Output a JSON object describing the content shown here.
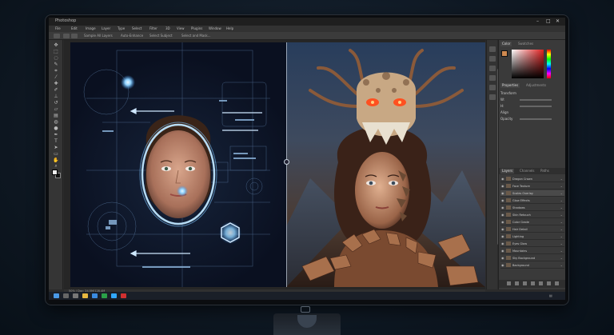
{
  "app": {
    "title": "Photoshop",
    "window_controls": [
      "–",
      "□",
      "✕"
    ]
  },
  "menu": {
    "items": [
      "File",
      "Edit",
      "Image",
      "Layer",
      "Type",
      "Select",
      "Filter",
      "3D",
      "View",
      "Plugins",
      "Window",
      "Help"
    ]
  },
  "options_bar": {
    "items": [
      "Sample All Layers",
      "Auto-Enhance",
      "Select Subject",
      "Select and Mask..."
    ]
  },
  "tools": {
    "items": [
      "move-tool-icon",
      "marquee-tool-icon",
      "lasso-tool-icon",
      "quick-select-tool-icon",
      "crop-tool-icon",
      "eyedropper-tool-icon",
      "healing-brush-tool-icon",
      "brush-tool-icon",
      "clone-stamp-tool-icon",
      "history-brush-tool-icon",
      "eraser-tool-icon",
      "gradient-tool-icon",
      "blur-tool-icon",
      "dodge-tool-icon",
      "pen-tool-icon",
      "type-tool-icon",
      "path-select-tool-icon",
      "shape-tool-icon",
      "hand-tool-icon",
      "zoom-tool-icon"
    ]
  },
  "panels": {
    "color_tab": "Color",
    "swatches_tab": "Swatches",
    "properties_tab": "Properties",
    "adjustments_tab": "Adjustments",
    "layers_tab": "Layers",
    "channels_tab": "Channels",
    "paths_tab": "Paths",
    "property_rows": [
      "Transform",
      "W:",
      "H:",
      "Align",
      "Opacity"
    ]
  },
  "layers": [
    {
      "name": "Dragon Crown",
      "selected": false
    },
    {
      "name": "Face Texture",
      "selected": false
    },
    {
      "name": "Scales Overlay",
      "selected": true
    },
    {
      "name": "Glow Effects",
      "selected": false
    },
    {
      "name": "Shadows",
      "selected": false
    },
    {
      "name": "Skin Retouch",
      "selected": false
    },
    {
      "name": "Color Grade",
      "selected": false
    },
    {
      "name": "Hair Detail",
      "selected": false
    },
    {
      "name": "Lighting",
      "selected": false
    },
    {
      "name": "Eyes Glow",
      "selected": false
    },
    {
      "name": "Mountains",
      "selected": false
    },
    {
      "name": "Sky Background",
      "selected": false
    },
    {
      "name": "Background",
      "selected": false
    }
  ],
  "status": {
    "text": "50% | Doc: 24.5M/128.4M"
  },
  "colors": {
    "foreground": "#d08a50",
    "accent_glow": "#8fd2ff",
    "dragon_eyes": "#ff5020"
  }
}
